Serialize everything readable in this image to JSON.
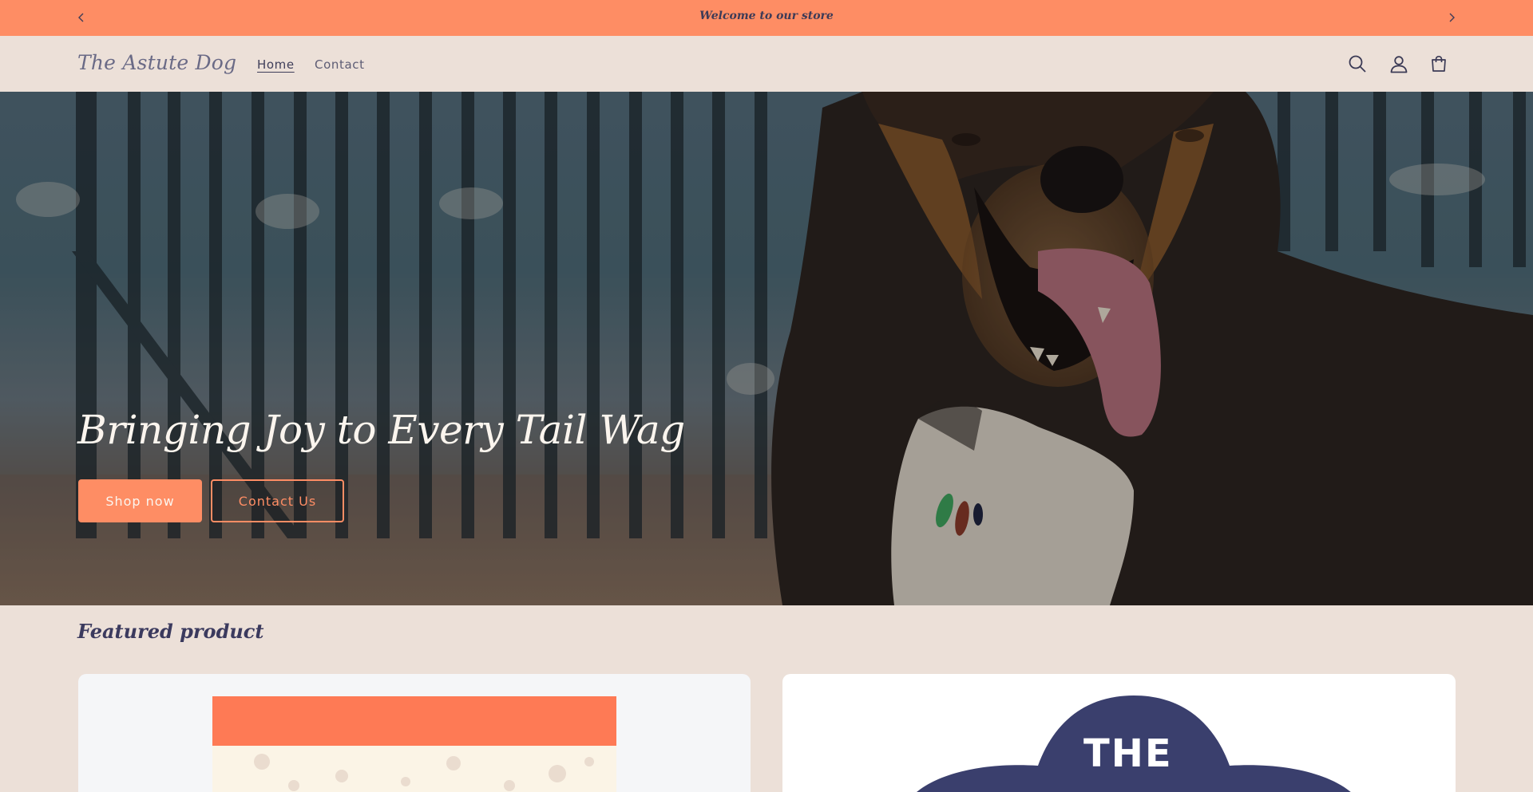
{
  "announcement": {
    "message": "Welcome to our store",
    "prev_icon": "chevron-left-icon",
    "next_icon": "chevron-right-icon"
  },
  "header": {
    "logo": "The Astute Dog",
    "nav": [
      {
        "label": "Home",
        "active": true
      },
      {
        "label": "Contact",
        "active": false
      }
    ],
    "icons": [
      "search-icon",
      "account-icon",
      "cart-icon"
    ]
  },
  "hero": {
    "title": "Bringing Joy to Every Tail Wag",
    "primary_button": "Shop now",
    "secondary_button": "Contact Us",
    "image": "dog-photo"
  },
  "featured": {
    "title": "Featured product",
    "badge_text": "THE"
  },
  "colors": {
    "accent": "#fe8d64",
    "background": "#ece0d8",
    "text": "#3b3a5e",
    "navy": "#3a3f6d"
  }
}
